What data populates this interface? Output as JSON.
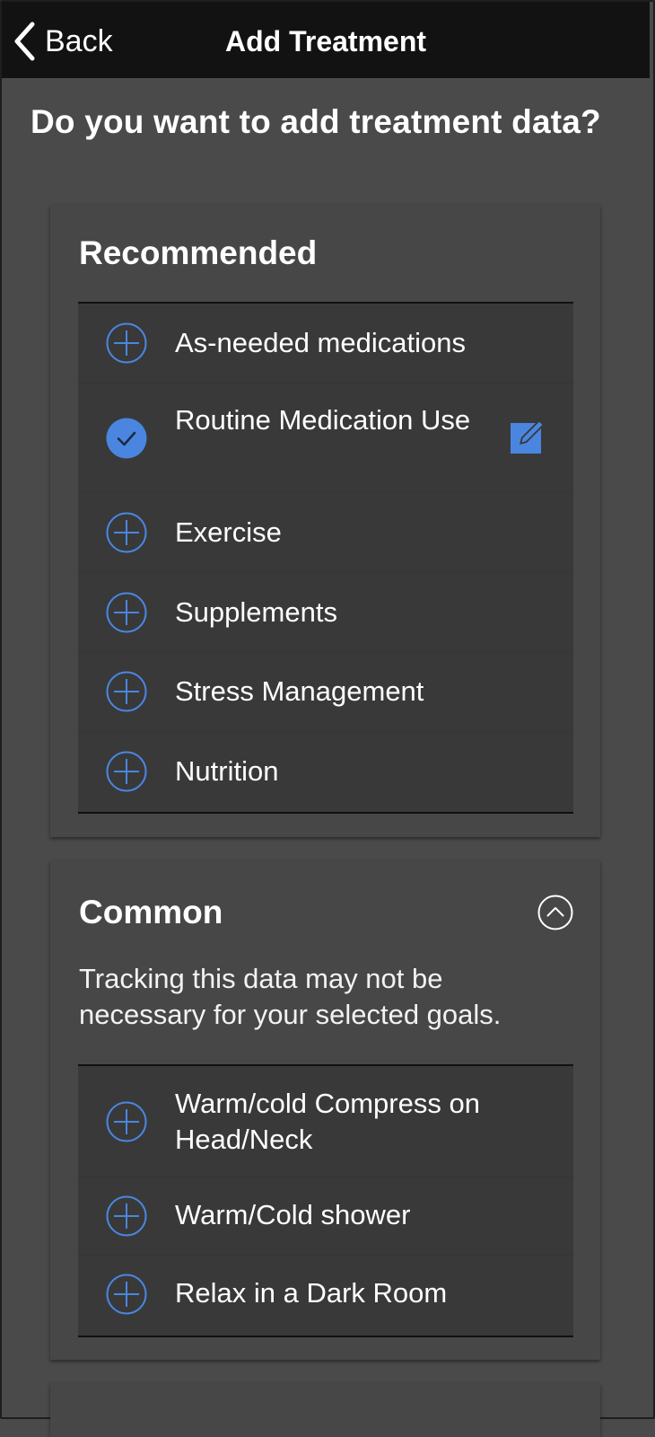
{
  "header": {
    "back_label": "Back",
    "title": "Add Treatment"
  },
  "question": "Do you want to add treatment data?",
  "recommended": {
    "title": "Recommended",
    "items": [
      {
        "label": "As-needed medications",
        "state": "add"
      },
      {
        "label": "Routine Medication Use",
        "state": "selected",
        "editable": true
      },
      {
        "label": "Exercise",
        "state": "add"
      },
      {
        "label": "Supplements",
        "state": "add"
      },
      {
        "label": "Stress Management",
        "state": "add"
      },
      {
        "label": "Nutrition",
        "state": "add"
      }
    ]
  },
  "common": {
    "title": "Common",
    "expanded": true,
    "note": "Tracking this data may not be necessary for your selected goals.",
    "items": [
      {
        "label": "Warm/cold Compress on Head/Neck",
        "state": "add"
      },
      {
        "label": "Warm/Cold shower",
        "state": "add"
      },
      {
        "label": "Relax in a Dark Room",
        "state": "add"
      }
    ]
  },
  "colors": {
    "accent": "#4a86e0",
    "background": "#4a4a4a",
    "navbar": "#121212",
    "card": "#474747",
    "list": "#393939"
  },
  "icons": {
    "back": "chevron-left-icon",
    "add": "plus-circle-icon",
    "selected": "check-circle-icon",
    "edit": "edit-square-icon",
    "collapse": "chevron-up-circle-icon"
  }
}
